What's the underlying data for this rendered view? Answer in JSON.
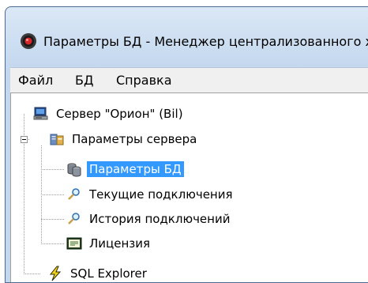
{
  "window": {
    "title": "Параметры БД - Менеджер централизованного хранилища"
  },
  "menu": {
    "items": [
      "Файл",
      "БД",
      "Справка"
    ]
  },
  "tree": {
    "root": {
      "label": "Сервер \"Орион\" (Bil)",
      "icon": "server-computer-icon"
    },
    "server_params": {
      "label": "Параметры сервера",
      "icon": "server-settings-icon",
      "expanded": true
    },
    "db_params": {
      "label": "Параметры БД",
      "icon": "database-icon",
      "selected": true
    },
    "current_connections": {
      "label": "Текущие подключения",
      "icon": "magnifier-icon"
    },
    "connection_history": {
      "label": "История подключений",
      "icon": "magnifier-icon"
    },
    "license": {
      "label": "Лицензия",
      "icon": "license-icon"
    },
    "sql_explorer": {
      "label": "SQL Explorer",
      "icon": "lightning-icon"
    }
  },
  "colors": {
    "selection": "#3399ff",
    "window_frame": "#c8dbf0"
  }
}
